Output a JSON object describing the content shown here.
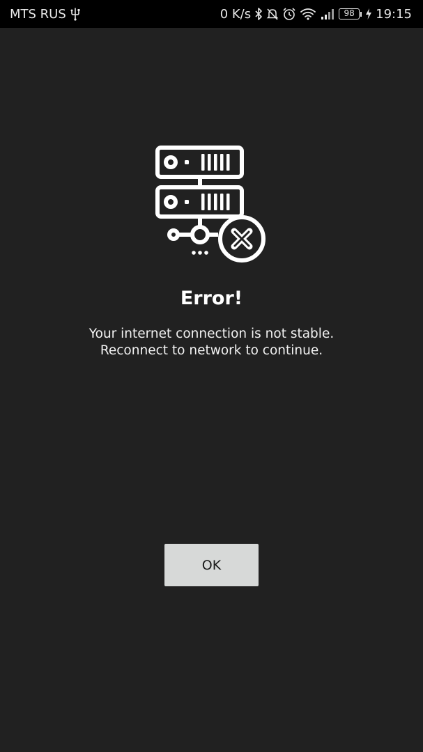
{
  "status_bar": {
    "carrier": "MTS RUS",
    "network_speed": "0 K/s",
    "battery_level": "98",
    "time": "19:15",
    "icons": [
      "usb-icon",
      "bluetooth-icon",
      "mute-icon",
      "alarm-icon",
      "wifi-icon",
      "signal-icon",
      "battery-icon",
      "charging-icon"
    ]
  },
  "dialog": {
    "illustration": "server-error-icon",
    "title": "Error!",
    "message_lines": [
      "Your internet connection is not stable.",
      "Reconnect to network to continue."
    ],
    "ok_label": "OK"
  },
  "colors": {
    "background": "#212121",
    "status_bar": "#000000",
    "button": "#d7d9d8",
    "text": "#ffffff"
  }
}
